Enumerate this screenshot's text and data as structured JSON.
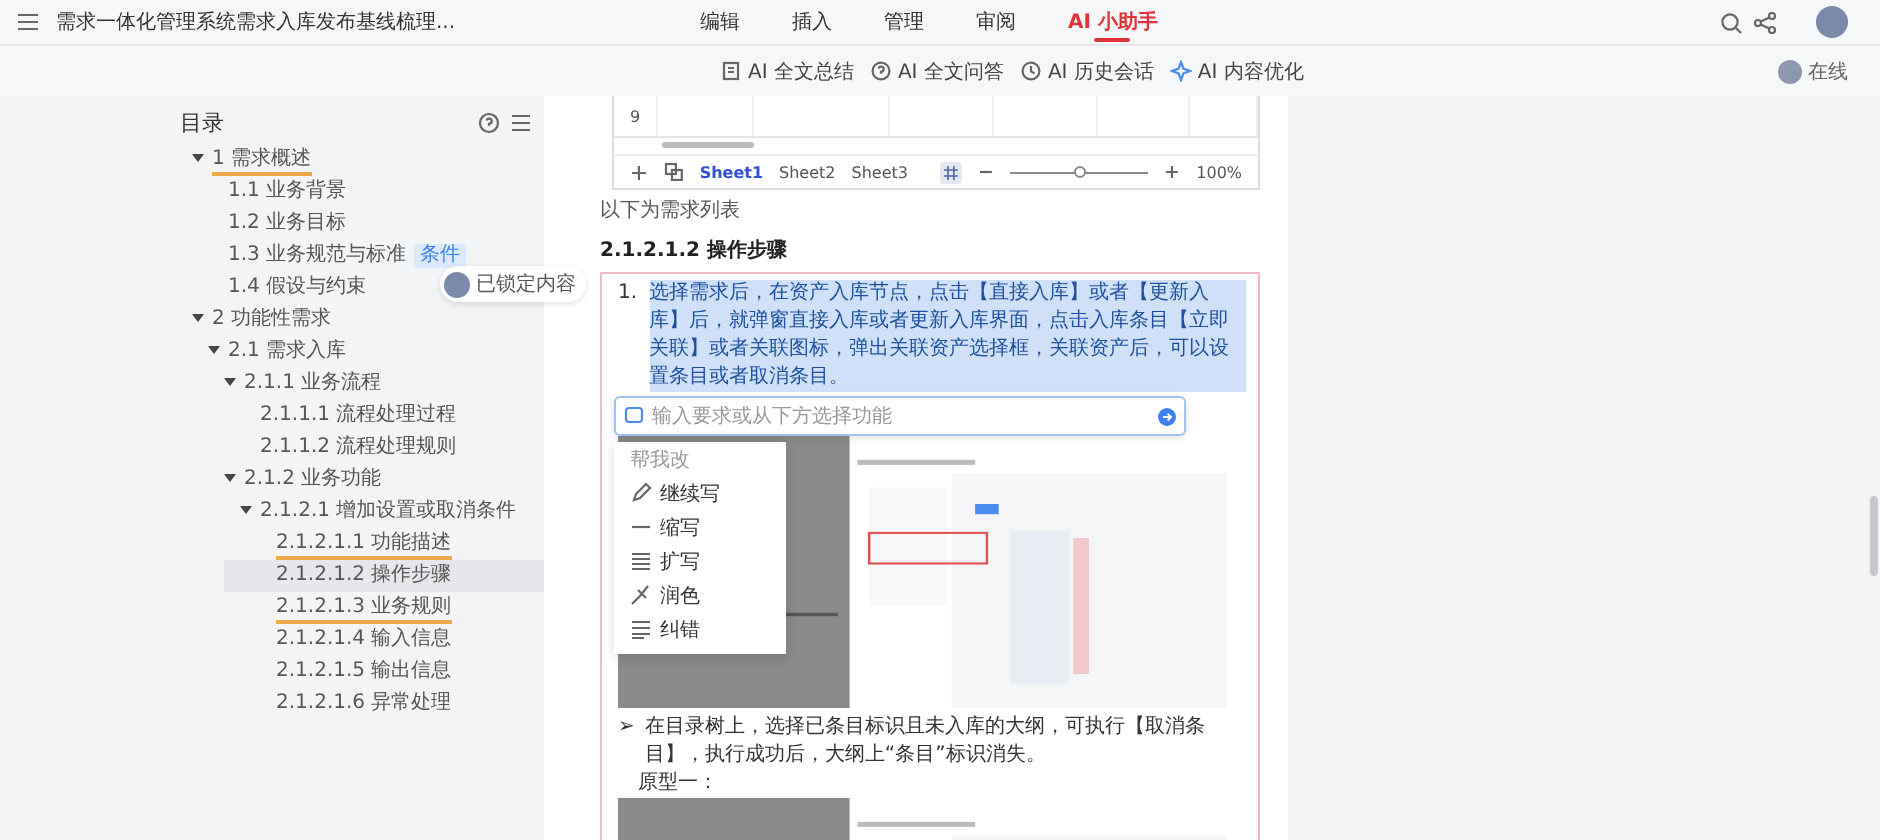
{
  "header": {
    "title": "需求一体化管理系统需求入库发布基线梳理..."
  },
  "tabs": [
    {
      "label": "编辑",
      "selected": false
    },
    {
      "label": "插入",
      "selected": false
    },
    {
      "label": "管理",
      "selected": false
    },
    {
      "label": "审阅",
      "selected": false
    },
    {
      "label": "AI 小助手",
      "selected": true
    }
  ],
  "ai_toolbar": {
    "buttons": [
      {
        "label": "AI 全文总结",
        "kind": "summary"
      },
      {
        "label": "AI 全文问答",
        "kind": "qa"
      },
      {
        "label": "AI 历史会话",
        "kind": "history"
      },
      {
        "label": "AI 内容优化",
        "kind": "optimize"
      }
    ],
    "status": "在线"
  },
  "toc": {
    "title": "目录",
    "items": [
      {
        "label": "1 需求概述",
        "expanded": true,
        "selected": false,
        "marked": true,
        "children": [
          {
            "label": "1.1 业务背景",
            "selected": false,
            "marked": false
          },
          {
            "label": "1.2 业务目标",
            "selected": false,
            "marked": false
          },
          {
            "label": "1.3 业务规范与标准",
            "tag": "条件",
            "selected": false,
            "marked": false
          },
          {
            "label": "1.4 假设与约束",
            "selected": false,
            "marked": false
          }
        ]
      },
      {
        "label": "2 功能性需求",
        "expanded": true,
        "selected": false,
        "marked": false,
        "children": [
          {
            "label": "2.1 需求入库",
            "expanded": true,
            "selected": false,
            "marked": false,
            "children": [
              {
                "label": "2.1.1 业务流程",
                "expanded": true,
                "selected": false,
                "marked": false,
                "children": [
                  {
                    "label": "2.1.1.1 流程处理过程",
                    "selected": false,
                    "marked": false
                  },
                  {
                    "label": "2.1.1.2 流程处理规则",
                    "selected": false,
                    "marked": false
                  }
                ]
              },
              {
                "label": "2.1.2 业务功能",
                "expanded": true,
                "selected": false,
                "marked": false,
                "children": [
                  {
                    "label": "2.1.2.1 增加设置或取消条件",
                    "expanded": true,
                    "selected": false,
                    "marked": false,
                    "children": [
                      {
                        "label": "2.1.2.1.1 功能描述",
                        "selected": false,
                        "marked": true
                      },
                      {
                        "label": "2.1.2.1.2 操作步骤",
                        "selected": true,
                        "marked": false
                      },
                      {
                        "label": "2.1.2.1.3 业务规则",
                        "selected": false,
                        "marked": true
                      },
                      {
                        "label": "2.1.2.1.4 输入信息",
                        "selected": false,
                        "marked": false
                      },
                      {
                        "label": "2.1.2.1.5 输出信息",
                        "selected": false,
                        "marked": false
                      },
                      {
                        "label": "2.1.2.1.6 异常处理",
                        "selected": false,
                        "marked": false
                      }
                    ]
                  }
                ]
              }
            ]
          }
        ]
      }
    ]
  },
  "comment": {
    "label": "已锁定内容"
  },
  "sheet": {
    "rows": [
      {
        "row_number": "9"
      }
    ],
    "sheets": [
      {
        "label": "Sheet1",
        "selected": true
      },
      {
        "label": "Sheet2",
        "selected": false
      },
      {
        "label": "Sheet3",
        "selected": false
      }
    ],
    "zoom_slider": {
      "level": 0.5
    },
    "zoom": "100%"
  },
  "document": {
    "caption": "以下为需求列表",
    "heading": "2.1.2.1.2 操作步骤",
    "steps": [
      {
        "number": "1.",
        "text": "选择需求后，在资产入库节点，点击【直接入库】或者【更新入库】后，就弹窗直接入库或者更新入库界面，点击入库条目【立即关联】或者关联图标，弹出关联资产选择框，关联资产后，可以设置条目或者取消条目。",
        "highlighted": true
      }
    ],
    "bullet": {
      "marker": "➢",
      "text": "在目录树上，选择已条目标识且未入库的大纲，可执行【取消条目】，执行成功后，大纲上“条目”标识消失。"
    },
    "prototype_label": "原型一："
  },
  "ai_popup": {
    "placeholder": "输入要求或从下方选择功能",
    "menu_title": "帮我改",
    "items": [
      {
        "label": "继续写",
        "kind": "continue"
      },
      {
        "label": "缩写",
        "kind": "shorten"
      },
      {
        "label": "扩写",
        "kind": "expand"
      },
      {
        "label": "润色",
        "kind": "polish"
      },
      {
        "label": "纠错",
        "kind": "correct"
      }
    ]
  }
}
